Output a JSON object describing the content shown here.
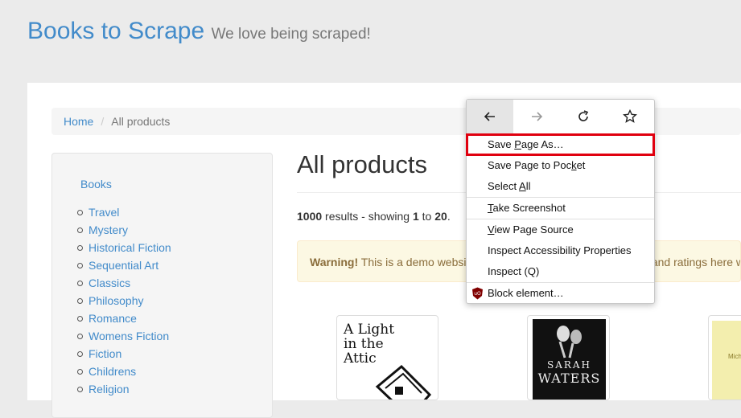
{
  "header": {
    "title": "Books to Scrape",
    "tagline": "We love being scraped!"
  },
  "breadcrumb": {
    "home": "Home",
    "separator": "/",
    "current": "All products"
  },
  "sidebar": {
    "top": "Books",
    "categories": [
      "Travel",
      "Mystery",
      "Historical Fiction",
      "Sequential Art",
      "Classics",
      "Philosophy",
      "Romance",
      "Womens Fiction",
      "Fiction",
      "Childrens",
      "Religion"
    ]
  },
  "main": {
    "heading": "All products",
    "results": {
      "count": "1000",
      "mid": " results - showing ",
      "from": "1",
      "to_word": " to ",
      "to": "20",
      "end": "."
    },
    "alert": {
      "strong": "Warning!",
      "text": " This is a demo website for web scraping purposes. Prices and ratings here were randomly assigned and have no real meaning."
    }
  },
  "books": [
    {
      "cover_text": "A Light in the Attic"
    },
    {
      "author": "SARAH",
      "author2": "WATERS"
    },
    {
      "cover_text": "Miche"
    }
  ],
  "context_menu": {
    "nav_icons": [
      "back-arrow-icon",
      "forward-arrow-icon",
      "reload-icon",
      "bookmark-star-icon"
    ],
    "items": {
      "save_page_as": {
        "pre": "Save ",
        "acc": "P",
        "post": "age As…"
      },
      "save_to_pocket": {
        "pre": "Save Page to Poc",
        "acc": "k",
        "post": "et"
      },
      "select_all": {
        "pre": "Select ",
        "acc": "A",
        "post": "ll"
      },
      "take_screenshot": {
        "pre": "",
        "acc": "T",
        "post": "ake Screenshot"
      },
      "view_source": {
        "pre": "",
        "acc": "V",
        "post": "iew Page Source"
      },
      "inspect_a11y": {
        "pre": "Inspect Accessibility Properties",
        "acc": "",
        "post": ""
      },
      "inspect": {
        "pre": "Inspect (Q)",
        "acc": "",
        "post": ""
      },
      "block_element": {
        "pre": "Block element…",
        "acc": "",
        "post": ""
      }
    },
    "highlight_color": "#e0000f"
  },
  "colors": {
    "link": "#428bca",
    "alert_bg": "#fcf8e3",
    "alert_text": "#8a6d3b"
  }
}
